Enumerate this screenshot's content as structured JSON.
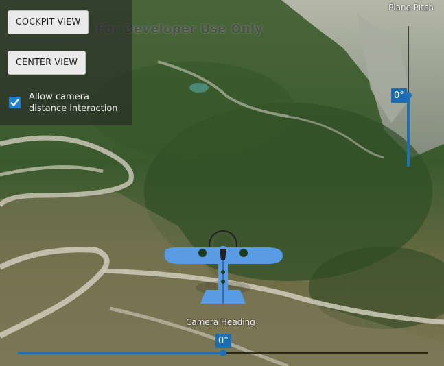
{
  "watermark": "For Developer Use Only",
  "toolbar": {
    "cockpit_label": "COCKPIT VIEW",
    "center_label": "CENTER VIEW",
    "allow_label": "Allow camera distance interaction",
    "allow_checked": true
  },
  "pitch": {
    "title": "Plane Pitch",
    "value_label": "0°",
    "value": 0
  },
  "heading": {
    "title": "Camera Heading",
    "value_label": "0°",
    "value": 0
  },
  "colors": {
    "accent": "#1a6cb3",
    "checkbox": "#1f7fd0",
    "plane": "#5a9be6"
  }
}
